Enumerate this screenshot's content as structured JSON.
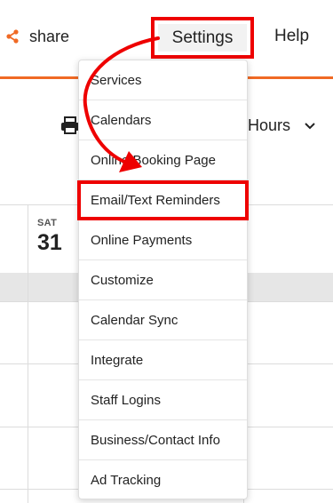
{
  "nav": {
    "share_label": "share",
    "settings_label": "Settings",
    "help_label": "Help"
  },
  "toolbar": {
    "hours_label": "Hours"
  },
  "calendar": {
    "day_name": "SAT",
    "day_number": "31"
  },
  "menu": {
    "items": [
      {
        "label": "Services"
      },
      {
        "label": "Calendars"
      },
      {
        "label": "Online Booking Page"
      },
      {
        "label": "Email/Text Reminders"
      },
      {
        "label": "Online Payments"
      },
      {
        "label": "Customize"
      },
      {
        "label": "Calendar Sync"
      },
      {
        "label": "Integrate"
      },
      {
        "label": "Staff Logins"
      },
      {
        "label": "Business/Contact Info"
      },
      {
        "label": "Ad Tracking"
      }
    ]
  },
  "colors": {
    "accent": "#f06a25",
    "highlight": "#ee0000"
  },
  "icons": {
    "share": "share-icon",
    "print": "printer-icon",
    "hours_dropdown": "chevron-down-icon"
  }
}
